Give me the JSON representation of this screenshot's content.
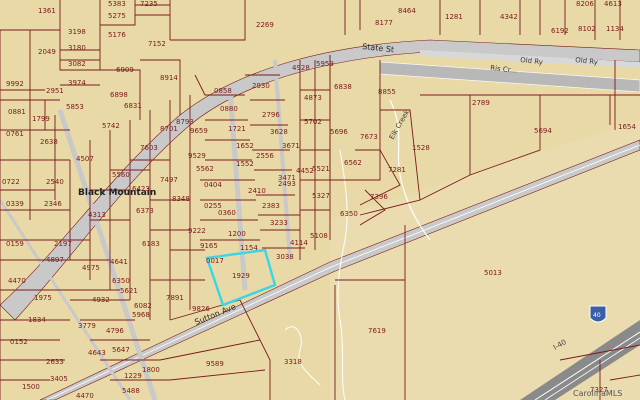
{
  "map": {
    "background": "#e9d9a6",
    "parcel_line_color": "#7a1a1a",
    "road_fill_color": "#c9c9c9",
    "road_line_color": "#ffffff",
    "highlight_color": "#39d6e8",
    "creek_color": "#ffffff",
    "interstate_color": "#8a8a8a"
  },
  "streets": {
    "state_st": "State St",
    "sutton_ave": "Sutton Ave",
    "elk_creek": "Elk Creek",
    "i40_label": "I-40",
    "interstate_badge": "40",
    "rail_label": "Old Ry",
    "upper_right_label": "Old Ry",
    "trail_label": "Ris Cr..."
  },
  "places": {
    "black_mountain": "Black Mountain"
  },
  "credit": "CarolinaMLS",
  "parcels": [
    "1361",
    "5383",
    "7235",
    "5275",
    "2269",
    "8464",
    "8177",
    "1281",
    "4342",
    "8206",
    "4613",
    "6192",
    "8102",
    "1134",
    "3198",
    "2049",
    "5176",
    "7152",
    "3180",
    "3082",
    "6909",
    "8914",
    "3974",
    "2951",
    "9992",
    "6898",
    "0881",
    "1799",
    "0761",
    "2638",
    "5853",
    "6831",
    "5742",
    "0858",
    "2930",
    "4928",
    "5959",
    "4873",
    "6838",
    "8855",
    "2789",
    "5694",
    "1654",
    "0880",
    "2796",
    "8701",
    "8793",
    "9659",
    "1721",
    "3628",
    "5702",
    "5696",
    "7673",
    "4507",
    "7603",
    "9529",
    "1652",
    "3671",
    "6562",
    "1528",
    "2540",
    "0722",
    "5560",
    "6423",
    "7497",
    "5562",
    "1552",
    "2556",
    "4452",
    "3471",
    "5521",
    "0339",
    "2346",
    "6373",
    "8348",
    "0404",
    "2410",
    "2493",
    "5327",
    "7281",
    "7396",
    "0255",
    "4313",
    "9222",
    "0360",
    "1200",
    "2383",
    "3233",
    "6350",
    "0159",
    "2197",
    "6183",
    "9165",
    "1154",
    "4114",
    "5108",
    "0017",
    "3038",
    "1929",
    "5013",
    "4975",
    "1975",
    "7891",
    "9826",
    "1834",
    "3779",
    "4796",
    "4932",
    "0152",
    "2633",
    "4643",
    "5647",
    "1500",
    "7619",
    "3318",
    "9589",
    "4470",
    "7327",
    "5488",
    "3405",
    "1229",
    "1800",
    "4470",
    "6350",
    "5621",
    "5968",
    "6082",
    "4897",
    "4641",
    "5052"
  ]
}
